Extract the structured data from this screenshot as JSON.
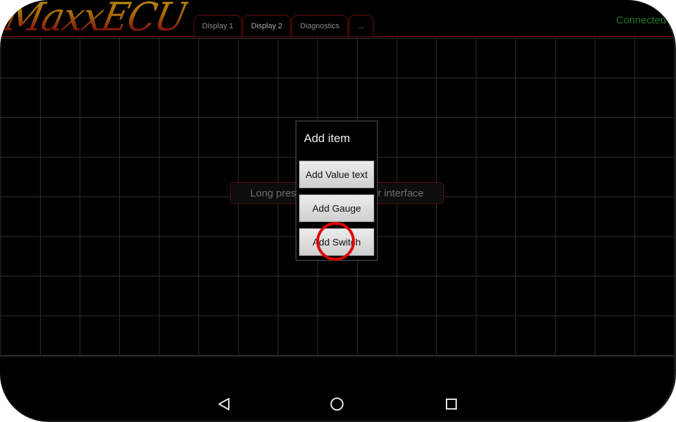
{
  "app": {
    "logo": "MaxxECU",
    "status": "Connected",
    "brand_color": "#7a0a0a",
    "status_color": "#1f7a1f"
  },
  "tabs": [
    {
      "label": "Display 1",
      "active": false
    },
    {
      "label": "Display 2",
      "active": true
    },
    {
      "label": "Diagnostics",
      "active": false
    },
    {
      "label": "...",
      "active": false
    }
  ],
  "canvas": {
    "hint": "Long press to configure your interface"
  },
  "dialog": {
    "title": "Add item",
    "buttons": [
      {
        "label": "Add Value text"
      },
      {
        "label": "Add Gauge"
      },
      {
        "label": "Add Switch"
      }
    ],
    "highlighted": "Add Switch"
  },
  "navbar": {
    "back": "back-icon",
    "home": "home-icon",
    "recents": "recents-icon"
  }
}
